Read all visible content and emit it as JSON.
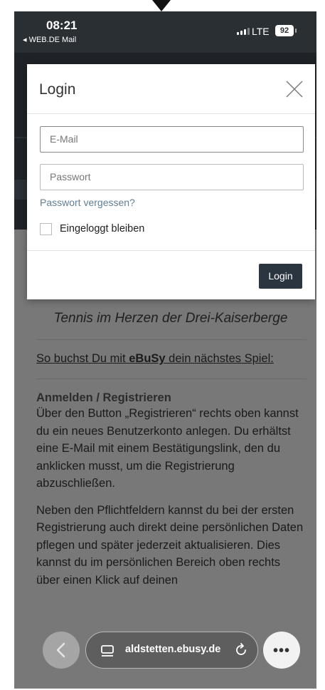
{
  "status_bar": {
    "time": "08:21",
    "back_app": "◂ WEB.DE Mail",
    "network": "LTE",
    "battery": "92"
  },
  "modal": {
    "title": "Login",
    "email_placeholder": "E-Mail",
    "password_placeholder": "Passwort",
    "forgot_password": "Passwort vergessen?",
    "remember_label": "Eingeloggt bleiben",
    "remember_checked": false,
    "login_button": "Login"
  },
  "page": {
    "tagline": "Tennis im Herzen der Drei-Kaiserberge",
    "howto_prefix": "So buchst Du mit ",
    "howto_brand": "eBuSy",
    "howto_suffix": " dein nächstes Spiel:",
    "section_title": "Anmelden / Registrieren",
    "paragraph_1": "Über den Button „Registrieren“ rechts oben kannst du ein neues Benutzerkonto anlegen. Du erhältst eine E-Mail mit einem Bestätigungslink, den du anklicken musst, um die Registrierung abzuschließen.",
    "paragraph_2": "Neben den Pflichtfeldern kannst du bei der ersten Registrierung auch direkt deine persönlichen Daten pflegen und später jederzeit aktualisieren. Dies kannst du im persönlichen Bereich oben rechts über einen Klick auf deinen"
  },
  "browser": {
    "url": "aldstetten.ebusy.de",
    "more_icon": "ellipsis-icon"
  }
}
